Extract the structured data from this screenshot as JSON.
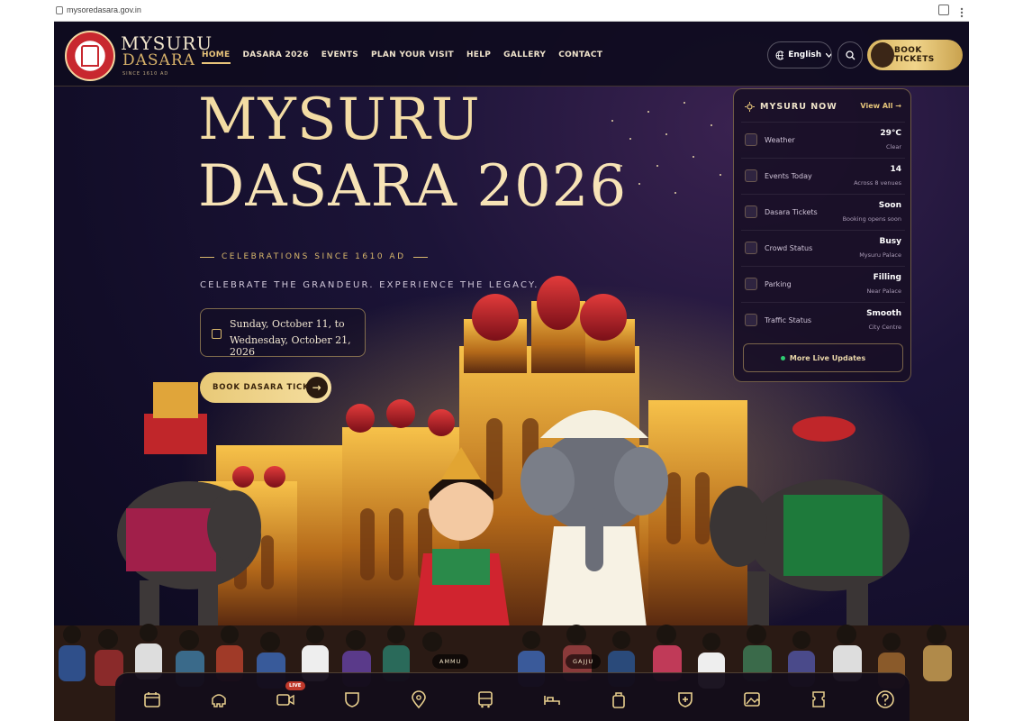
{
  "browser": {
    "url": "mysoredasara.gov.in"
  },
  "header": {
    "logo_line1": "MYSURU",
    "logo_line2": "DASARA",
    "logo_line3": "SINCE 1610 AD",
    "nav": [
      "HOME",
      "DASARA 2026",
      "EVENTS",
      "PLAN YOUR VISIT",
      "HELP",
      "GALLERY",
      "CONTACT"
    ],
    "language": "English",
    "book_tickets": "BOOK TICKETS"
  },
  "hero": {
    "title_line1": "MYSURU",
    "title_line2": "DASARA 2026",
    "since": "CELEBRATIONS SINCE 1610 AD",
    "tagline": "CELEBRATE THE GRANDEUR. EXPERIENCE THE LEGACY.",
    "date_line1": "Sunday, October 11, to",
    "date_line2": "Wednesday, October 21, 2026",
    "cta": "BOOK DASARA TICKETS",
    "mascot_left": "AMMU",
    "mascot_right": "GAJJU"
  },
  "now_panel": {
    "title": "MYSURU NOW",
    "view_all": "View All",
    "more": "More Live Updates",
    "rows": [
      {
        "icon": "sun-icon",
        "label": "Weather",
        "value": "29°C",
        "sub": "Clear"
      },
      {
        "icon": "calendar-icon",
        "label": "Events Today",
        "value": "14",
        "sub": "Across 8 venues"
      },
      {
        "icon": "ticket-icon",
        "label": "Dasara Tickets",
        "value": "Soon",
        "sub": "Booking opens soon"
      },
      {
        "icon": "people-icon",
        "label": "Crowd Status",
        "value": "Busy",
        "sub": "Mysuru Palace"
      },
      {
        "icon": "parking-icon",
        "label": "Parking",
        "value": "Filling",
        "sub": "Near Palace"
      },
      {
        "icon": "car-icon",
        "label": "Traffic Status",
        "value": "Smooth",
        "sub": "City Centre"
      }
    ]
  },
  "bottom_bar": {
    "live_badge": "LIVE",
    "icons": [
      "calendar-icon",
      "elephant-icon",
      "video-icon",
      "shield-icon",
      "map-pin-icon",
      "bus-icon",
      "bed-icon",
      "bag-icon",
      "medical-shield-icon",
      "image-icon",
      "ticket-icon",
      "help-icon"
    ]
  },
  "colors": {
    "accent_gold": "#d9b86c",
    "bg_dark": "#120d28",
    "brand_red": "#c8282f"
  }
}
